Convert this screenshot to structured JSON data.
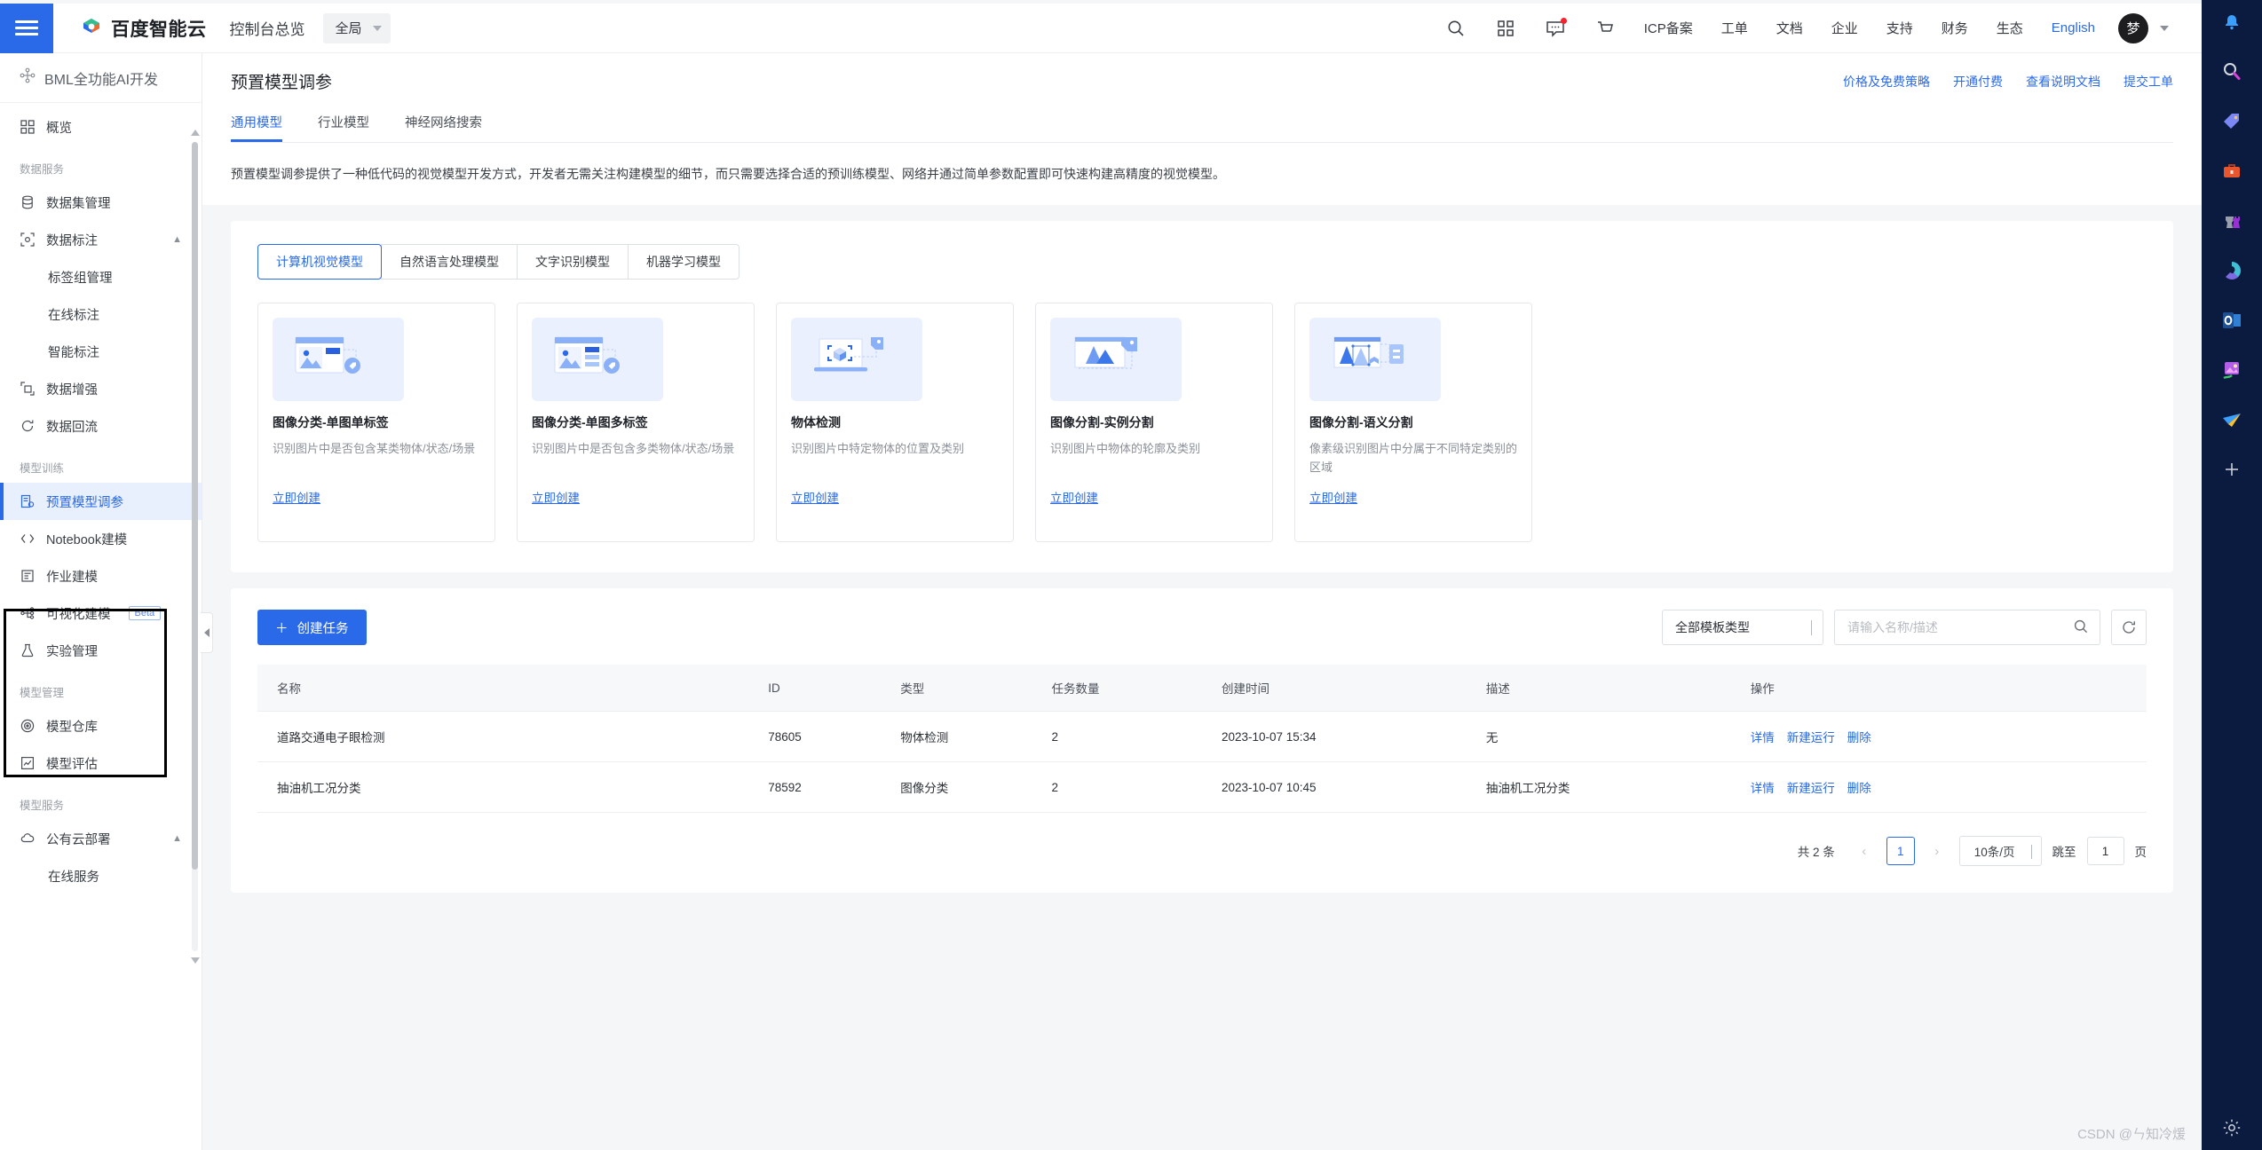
{
  "topbar": {
    "menu_icon": "hamburger-icon",
    "brand": "百度智能云",
    "console_title": "控制台总览",
    "scope": "全局",
    "icons": [
      "search-icon",
      "apps-grid-icon",
      "message-icon",
      "cart-icon"
    ],
    "links": [
      "ICP备案",
      "工单",
      "文档",
      "企业",
      "支持",
      "财务",
      "生态"
    ],
    "language": "English",
    "avatar": "梦"
  },
  "sidebar": {
    "product": "BML全功能AI开发",
    "items": [
      {
        "label": "概览",
        "icon": "grid-icon",
        "type": "item"
      },
      {
        "label": "数据服务",
        "type": "group"
      },
      {
        "label": "数据集管理",
        "icon": "database-icon",
        "type": "item"
      },
      {
        "label": "数据标注",
        "icon": "annotate-icon",
        "type": "item",
        "expanded": true
      },
      {
        "label": "标签组管理",
        "type": "sub"
      },
      {
        "label": "在线标注",
        "type": "sub"
      },
      {
        "label": "智能标注",
        "type": "sub"
      },
      {
        "label": "数据增强",
        "icon": "expand-icon",
        "type": "item"
      },
      {
        "label": "数据回流",
        "icon": "refresh-icon",
        "type": "item"
      },
      {
        "label": "模型训练",
        "type": "group"
      },
      {
        "label": "预置模型调参",
        "icon": "tune-icon",
        "type": "item",
        "active": true
      },
      {
        "label": "Notebook建模",
        "icon": "code-icon",
        "type": "item"
      },
      {
        "label": "作业建模",
        "icon": "job-icon",
        "type": "item"
      },
      {
        "label": "可视化建模",
        "icon": "flow-icon",
        "type": "item",
        "badge": "Beta"
      },
      {
        "label": "实验管理",
        "icon": "flask-icon",
        "type": "item"
      },
      {
        "label": "模型管理",
        "type": "group"
      },
      {
        "label": "模型仓库",
        "icon": "target-icon",
        "type": "item"
      },
      {
        "label": "模型评估",
        "icon": "evaluate-icon",
        "type": "item"
      },
      {
        "label": "模型服务",
        "type": "group"
      },
      {
        "label": "公有云部署",
        "icon": "cloud-icon",
        "type": "item",
        "expanded": true
      },
      {
        "label": "在线服务",
        "type": "sub"
      }
    ]
  },
  "page": {
    "title": "预置模型调参",
    "head_links": [
      "价格及免费策略",
      "开通付费",
      "查看说明文档",
      "提交工单"
    ],
    "tabs": [
      {
        "label": "通用模型",
        "active": true
      },
      {
        "label": "行业模型",
        "active": false
      },
      {
        "label": "神经网络搜索",
        "active": false
      }
    ],
    "notice": "预置模型调参提供了一种低代码的视觉模型开发方式，开发者无需关注构建模型的细节，而只需要选择合适的预训练模型、网络并通过简单参数配置即可快速构建高精度的视觉模型。"
  },
  "model_types": [
    {
      "label": "计算机视觉模型",
      "active": true
    },
    {
      "label": "自然语言处理模型",
      "active": false
    },
    {
      "label": "文字识别模型",
      "active": false
    },
    {
      "label": "机器学习模型",
      "active": false
    }
  ],
  "cards": [
    {
      "thumb": "image-single-label-icon",
      "title": "图像分类-单图单标签",
      "desc": "识别图片中是否包含某类物体/状态/场景",
      "link": "立即创建"
    },
    {
      "thumb": "image-multi-label-icon",
      "title": "图像分类-单图多标签",
      "desc": "识别图片中是否包含多类物体/状态/场景",
      "link": "立即创建"
    },
    {
      "thumb": "object-detection-icon",
      "title": "物体检测",
      "desc": "识别图片中特定物体的位置及类别",
      "link": "立即创建"
    },
    {
      "thumb": "instance-segmentation-icon",
      "title": "图像分割-实例分割",
      "desc": "识别图片中物体的轮廓及类别",
      "link": "立即创建"
    },
    {
      "thumb": "semantic-segmentation-icon",
      "title": "图像分割-语义分割",
      "desc": "像素级识别图片中分属于不同特定类别的区域",
      "link": "立即创建"
    }
  ],
  "list": {
    "create_button": "创建任务",
    "filter_select": "全部模板类型",
    "search_placeholder": "请输入名称/描述",
    "search_value": "",
    "refresh_icon": "refresh-icon",
    "columns": [
      "名称",
      "ID",
      "类型",
      "任务数量",
      "创建时间",
      "描述",
      "操作"
    ],
    "rows": [
      {
        "name": "道路交通电子眼检测",
        "id": "78605",
        "type": "物体检测",
        "task_count": "2",
        "created": "2023-10-07 15:34",
        "desc": "无",
        "actions": [
          "详情",
          "新建运行",
          "删除"
        ]
      },
      {
        "name": "抽油机工况分类",
        "id": "78592",
        "type": "图像分类",
        "task_count": "2",
        "created": "2023-10-07 10:45",
        "desc": "抽油机工况分类",
        "actions": [
          "详情",
          "新建运行",
          "删除"
        ]
      }
    ],
    "pagination": {
      "total": "共 2 条",
      "current": "1",
      "page_size": "10条/页",
      "jump_label": "跳至",
      "jump_value": "1",
      "page_unit": "页"
    }
  },
  "dock": [
    "heart-icon",
    "help-icon",
    "phone-icon",
    "grid-icon"
  ],
  "watermark": "CSDN @ㄣ知冷煖",
  "colors": {
    "accent": "#2a6ae9",
    "rail_bg": "#0b1b3f",
    "page_bg": "#f5f6f8"
  }
}
